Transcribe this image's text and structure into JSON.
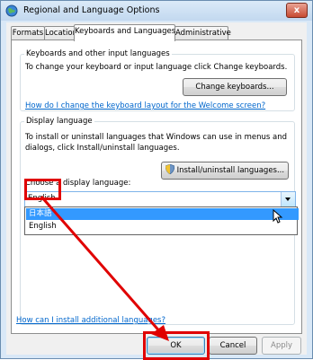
{
  "window": {
    "title": "Regional and Language Options",
    "close": "x"
  },
  "tabs": [
    "Formats",
    "Location",
    "Keyboards and Languages",
    "Administrative"
  ],
  "keyboards": {
    "title": "Keyboards and other input languages",
    "desc": "To change your keyboard or input language click Change keyboards.",
    "button": "Change keyboards...",
    "link": "How do I change the keyboard layout for the Welcome screen?"
  },
  "display": {
    "title": "Display language",
    "desc": "To install or uninstall languages that Windows can use in menus and dialogs, click Install/uninstall languages.",
    "button": "Install/uninstall languages...",
    "choose_label": "Choose a display language:",
    "selected": "English",
    "options": [
      "日本語",
      "English"
    ]
  },
  "footer": {
    "link": "How can I install additional languages?"
  },
  "buttons": {
    "ok": "OK",
    "cancel": "Cancel",
    "apply": "Apply"
  },
  "colors": {
    "highlight": "#e00000",
    "selection": "#3399ff",
    "link": "#0066cc"
  }
}
